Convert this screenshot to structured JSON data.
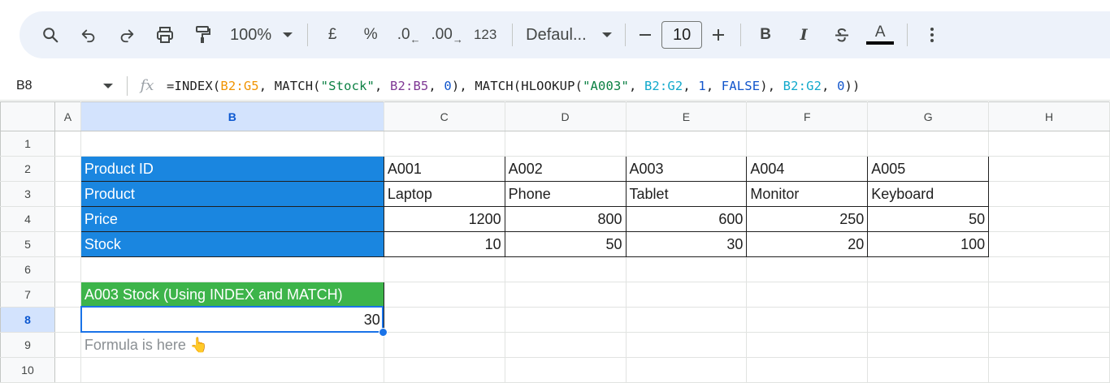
{
  "toolbar": {
    "zoom": "100%",
    "currency": "£",
    "percent": "%",
    "decrease_decimal": ".0",
    "increase_decimal": ".00",
    "number_format": "123",
    "font": "Defaul...",
    "font_size": "10",
    "bold": "B",
    "italic": "I",
    "text_color": "A",
    "text_color_value": "#000000"
  },
  "formula_bar": {
    "cell_ref": "B8",
    "fx": "fx",
    "tokens": [
      {
        "t": "=INDEX(",
        "c": ""
      },
      {
        "t": "B2:G5",
        "c": "c-or"
      },
      {
        "t": ", MATCH(",
        "c": ""
      },
      {
        "t": "\"Stock\"",
        "c": "c-str"
      },
      {
        "t": ", ",
        "c": ""
      },
      {
        "t": "B2:B5",
        "c": "c-pu"
      },
      {
        "t": ", ",
        "c": ""
      },
      {
        "t": "0",
        "c": "c-num"
      },
      {
        "t": "), MATCH(HLOOKUP(",
        "c": ""
      },
      {
        "t": "\"A003\"",
        "c": "c-str"
      },
      {
        "t": ", ",
        "c": ""
      },
      {
        "t": "B2:G2",
        "c": "c-cy"
      },
      {
        "t": ", ",
        "c": ""
      },
      {
        "t": "1",
        "c": "c-num"
      },
      {
        "t": ", ",
        "c": ""
      },
      {
        "t": "FALSE",
        "c": "c-num"
      },
      {
        "t": "), ",
        "c": ""
      },
      {
        "t": "B2:G2",
        "c": "c-cy"
      },
      {
        "t": ", ",
        "c": ""
      },
      {
        "t": "0",
        "c": "c-num"
      },
      {
        "t": "))",
        "c": ""
      }
    ]
  },
  "columns": [
    "A",
    "B",
    "C",
    "D",
    "E",
    "F",
    "G",
    "H"
  ],
  "rows": [
    "1",
    "2",
    "3",
    "4",
    "5",
    "6",
    "7",
    "8",
    "9",
    "10"
  ],
  "selected_column": "B",
  "selected_row": "8",
  "table": {
    "row_labels": [
      "Product ID",
      "Product",
      "Price",
      "Stock"
    ],
    "product_ids": [
      "A001",
      "A002",
      "A003",
      "A004",
      "A005"
    ],
    "products": [
      "Laptop",
      "Phone",
      "Tablet",
      "Monitor",
      "Keyboard"
    ],
    "prices": [
      "1200",
      "800",
      "600",
      "250",
      "50"
    ],
    "stock": [
      "10",
      "50",
      "30",
      "20",
      "100"
    ]
  },
  "result": {
    "header": "A003 Stock (Using INDEX and MATCH)",
    "value": "30",
    "note": "Formula is here 👆"
  },
  "colors": {
    "header_blue": "#1a86e0",
    "header_green": "#3db44a",
    "selection": "#1a73e8"
  }
}
